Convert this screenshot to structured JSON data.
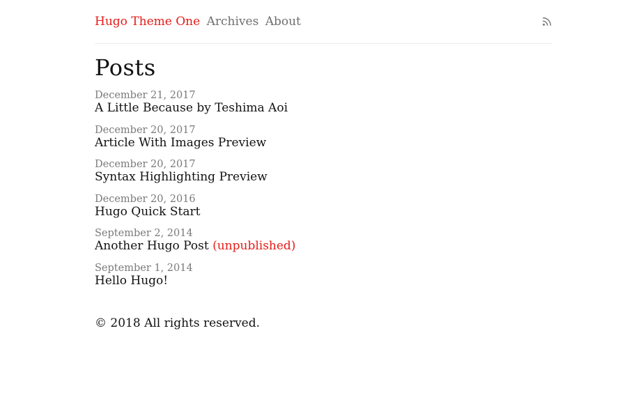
{
  "nav": {
    "brand": "Hugo Theme One",
    "links": [
      "Archives",
      "About"
    ],
    "rss_icon": "rss-icon",
    "accent_color": "#e51c17"
  },
  "page": {
    "title": "Posts"
  },
  "posts": [
    {
      "date": "December 21, 2017",
      "title": "A Little Because by Teshima Aoi",
      "status": ""
    },
    {
      "date": "December 20, 2017",
      "title": "Article With Images Preview",
      "status": ""
    },
    {
      "date": "December 20, 2017",
      "title": "Syntax Highlighting Preview",
      "status": ""
    },
    {
      "date": "December 20, 2016",
      "title": "Hugo Quick Start",
      "status": ""
    },
    {
      "date": "September 2, 2014",
      "title": "Another Hugo Post",
      "status": "(unpublished)"
    },
    {
      "date": "September 1, 2014",
      "title": "Hello Hugo!",
      "status": ""
    }
  ],
  "footer": {
    "copyright": "© 2018 All rights reserved."
  }
}
